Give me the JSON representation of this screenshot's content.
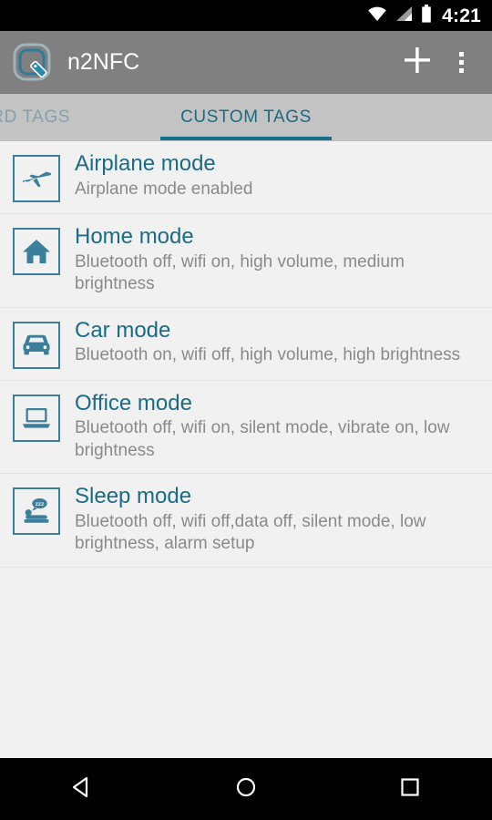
{
  "status_bar": {
    "time": "4:21",
    "icons": [
      "wifi-icon",
      "cellular-signal-icon",
      "battery-icon"
    ],
    "background": "#000000"
  },
  "app_bar": {
    "app_icon": "n2nfc-app-icon",
    "title": "n2NFC",
    "background": "#808080",
    "actions": [
      {
        "name": "add-tag-button",
        "icon": "plus-icon",
        "label": "Add"
      },
      {
        "name": "overflow-menu-button",
        "icon": "more-vertical-icon",
        "label": "More options"
      }
    ]
  },
  "tabs": {
    "background": "#c3c3c3",
    "active_color": "#1a6b86",
    "inactive_color": "#7fa3ad",
    "indicator_color": "#15708c",
    "items": [
      {
        "label": "ARD TAGS",
        "active": false
      },
      {
        "label": "CUSTOM TAGS",
        "active": true
      }
    ]
  },
  "list": {
    "background": "#f1f1f1",
    "title_color": "#1a6b86",
    "subtitle_color": "#8a8a8a",
    "icon_border_color": "#3b7f9b",
    "items": [
      {
        "icon": "airplane-icon",
        "title": "Airplane mode",
        "subtitle": "Airplane mode enabled"
      },
      {
        "icon": "home-icon",
        "title": "Home mode",
        "subtitle": "Bluetooth off, wifi on, high volume, medium brightness"
      },
      {
        "icon": "car-icon",
        "title": "Car mode",
        "subtitle": "Bluetooth on, wifi off, high volume, high brightness"
      },
      {
        "icon": "laptop-icon",
        "title": "Office mode",
        "subtitle": "Bluetooth off, wifi on, silent mode, vibrate on, low brightness"
      },
      {
        "icon": "sleep-bed-icon",
        "title": "Sleep mode",
        "subtitle": "Bluetooth off, wifi off,data off, silent mode, low brightness, alarm setup"
      }
    ]
  },
  "nav_bar": {
    "background": "#000000",
    "buttons": [
      {
        "name": "back-button",
        "icon": "back-triangle-icon",
        "label": "Back"
      },
      {
        "name": "home-button",
        "icon": "home-circle-icon",
        "label": "Home"
      },
      {
        "name": "recents-button",
        "icon": "recents-square-icon",
        "label": "Recents"
      }
    ]
  }
}
